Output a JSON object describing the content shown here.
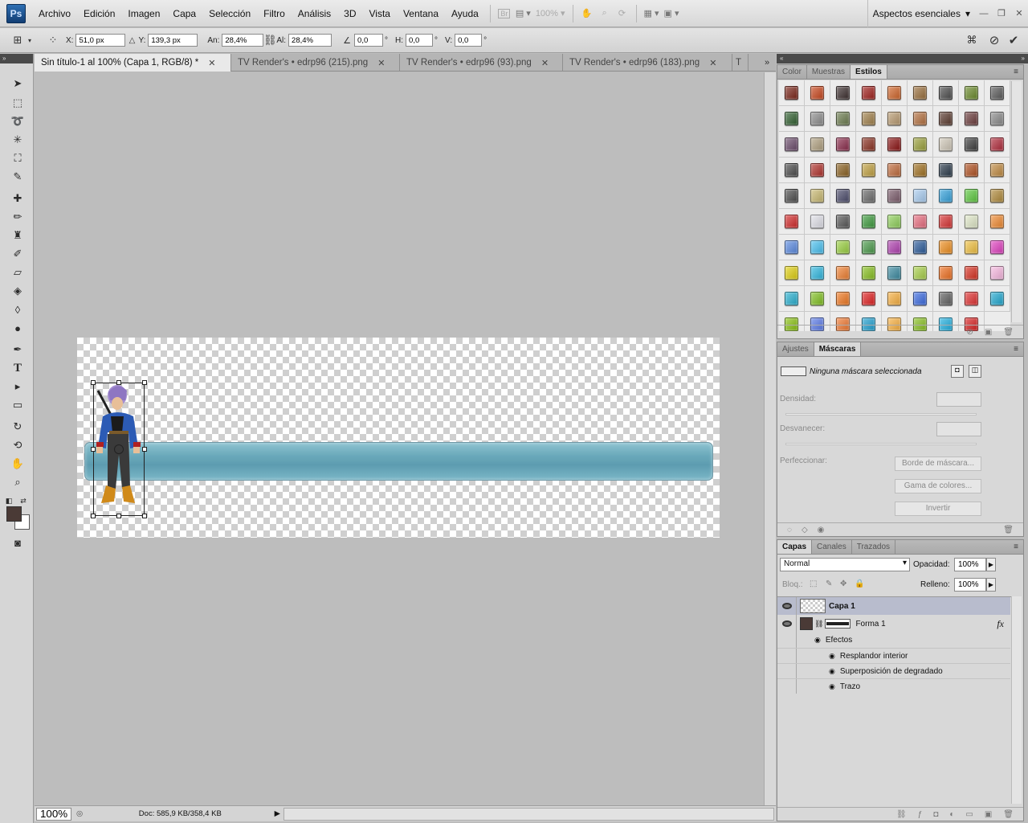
{
  "app": {
    "logo": "Ps"
  },
  "menu": [
    "Archivo",
    "Edición",
    "Imagen",
    "Capa",
    "Selección",
    "Filtro",
    "Análisis",
    "3D",
    "Vista",
    "Ventana",
    "Ayuda"
  ],
  "menubar": {
    "bridge_label": "Br",
    "zoom_value": "100%",
    "workspace": "Aspectos esenciales"
  },
  "options": {
    "x_label": "X:",
    "x_value": "51,0 px",
    "y_label": "Y:",
    "y_value": "139,3 px",
    "w_label": "An:",
    "w_value": "28,4%",
    "h_label": "Al:",
    "h_value": "28,4%",
    "rot_value": "0,0",
    "rot_unit": "°",
    "hskew_label": "H:",
    "hskew_value": "0,0",
    "hskew_unit": "°",
    "vskew_label": "V:",
    "vskew_value": "0,0",
    "vskew_unit": "°"
  },
  "tabs": [
    {
      "label": "Sin título-1 al 100% (Capa 1, RGB/8) *",
      "active": true
    },
    {
      "label": "TV Render's • edrp96 (215).png",
      "active": false
    },
    {
      "label": "TV Render's • edrp96 (93).png",
      "active": false
    },
    {
      "label": "TV Render's • edrp96 (183).png",
      "active": false
    },
    {
      "label": "T",
      "active": false
    }
  ],
  "status": {
    "zoom": "100%",
    "doc": "Doc: 585,9 KB/358,4 KB"
  },
  "styles_panel": {
    "tabs": [
      "Color",
      "Muestras",
      "Estilos"
    ],
    "active_tab": "Estilos",
    "swatches": [
      "#7a2418",
      "#c8461c",
      "#3b2d2d",
      "#a0201c",
      "#d06428",
      "#9a6f3c",
      "#4d4d4d",
      "#6a8a2a",
      "#5a5a5a",
      "#2f5e2e",
      "#8d8d8d",
      "#6b7b4e",
      "#a0804a",
      "#b89a70",
      "#b36f3e",
      "#5a3a2e",
      "#6a3a3a",
      "#8a8a8a",
      "#6a4a6a",
      "#b0a080",
      "#8a2a4a",
      "#8a3020",
      "#8a1010",
      "#9aa03a",
      "#d0c8b8",
      "#3a3a3a",
      "#b02a3a",
      "#4a4a4a",
      "#b0302a",
      "#8a6020",
      "#c0a040",
      "#c06a3a",
      "#a07020",
      "#2a3a4a",
      "#b05020",
      "#c08a40",
      "#4a4a4a",
      "#c8b870",
      "#4a4a6a",
      "#6a6a6a",
      "#7a5a6a",
      "#a8ccf0",
      "#34a2dc",
      "#5cc83e",
      "#b08a3a",
      "#d22a2a",
      "#e0e0e8",
      "#555555",
      "#3c9a3c",
      "#8fd05a",
      "#e86d7f",
      "#d83232",
      "#e0e8c8",
      "#f08a30",
      "#5a8ae0",
      "#48c0f0",
      "#9ad040",
      "#4a9a4a",
      "#b040b0",
      "#2a5a9a",
      "#f09020",
      "#f0c040",
      "#e040c0",
      "#e0d010",
      "#30b8e0",
      "#f08030",
      "#88c020",
      "#3a8aa0",
      "#a8d048",
      "#f07020",
      "#d83020",
      "#f8b8e0",
      "#28b0d0",
      "#80c020",
      "#f07820",
      "#e02020",
      "#f8b040",
      "#3a6ae0",
      "#606060",
      "#e03030",
      "#20a8d0",
      "#88c010",
      "#5a7ae8",
      "#f07830",
      "#20a0d0",
      "#f8b040",
      "#88c020",
      "#20b0e0",
      "#d82020"
    ]
  },
  "masks_panel": {
    "tabs": [
      "Ajustes",
      "Máscaras"
    ],
    "active_tab": "Máscaras",
    "status_text": "Ninguna máscara seleccionada",
    "density_label": "Densidad:",
    "feather_label": "Desvanecer:",
    "refine_label": "Perfeccionar:",
    "mask_edge_btn": "Borde de máscara...",
    "color_range_btn": "Gama de colores...",
    "invert_btn": "Invertir"
  },
  "layers_panel": {
    "tabs": [
      "Capas",
      "Canales",
      "Trazados"
    ],
    "active_tab": "Capas",
    "blend_mode": "Normal",
    "opacity_label": "Opacidad:",
    "opacity_value": "100%",
    "lock_label": "Bloq.:",
    "fill_label": "Relleno:",
    "fill_value": "100%",
    "layers": [
      {
        "name": "Capa 1",
        "selected": true
      },
      {
        "name": "Forma 1",
        "selected": false,
        "fx": "fx"
      }
    ],
    "effects_label": "Efectos",
    "effects": [
      "Resplandor interior",
      "Superposición de degradado",
      "Trazo"
    ]
  },
  "colors": {
    "foreground": "#4a3a36",
    "background": "#ffffff",
    "bar_fill": "#6aa9ba"
  }
}
